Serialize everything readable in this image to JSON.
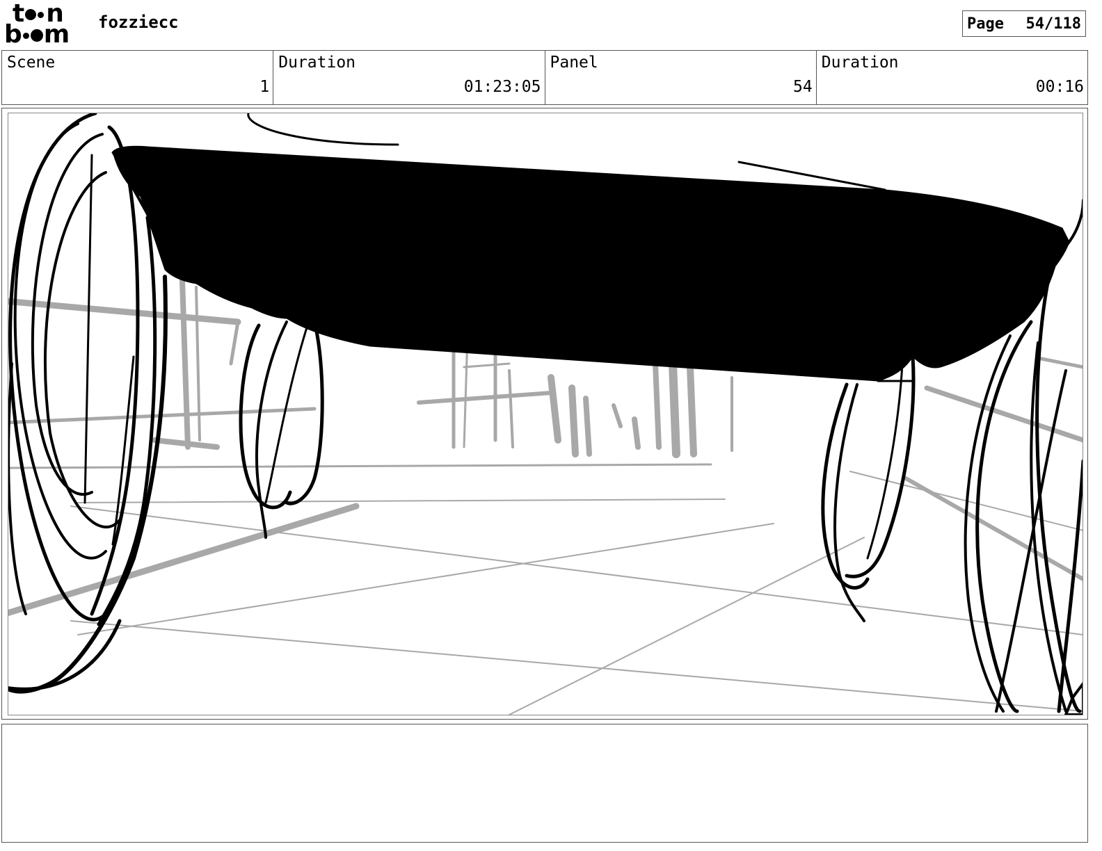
{
  "header": {
    "logo_top": "t",
    "logo_top_end": "n",
    "logo_bottom_start": "b",
    "logo_bottom_end": "m",
    "project_name": "fozziecc",
    "page_label": "Page",
    "page_value": "54/118"
  },
  "info": [
    {
      "label": "Scene",
      "value": "1"
    },
    {
      "label": "Duration",
      "value": "01:23:05"
    },
    {
      "label": "Panel",
      "value": "54"
    },
    {
      "label": "Duration",
      "value": "00:16"
    }
  ],
  "drawing": {
    "ink_color": "#000000",
    "sketch_color": "#a8a8a8"
  },
  "notes": {
    "text": ""
  }
}
